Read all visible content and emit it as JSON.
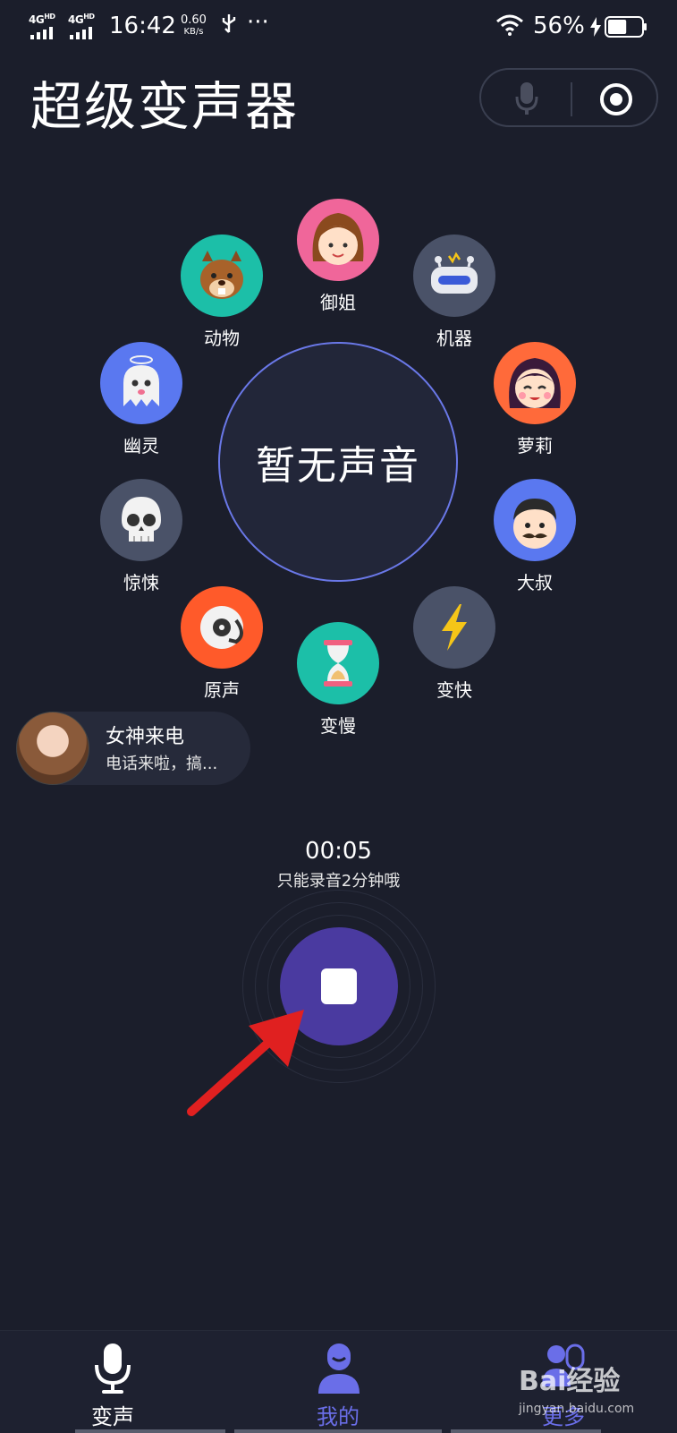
{
  "status_bar": {
    "network1": "4G",
    "network1_sup": "HD",
    "network2": "4G",
    "network2_sup": "HD",
    "time": "16:42",
    "speed_value": "0.60",
    "speed_unit": "KB/s",
    "more": "···",
    "battery": "56%",
    "battery_level": 0.56
  },
  "header": {
    "title": "超级变声器"
  },
  "center": {
    "label": "暂无声音"
  },
  "voices": [
    {
      "label": "御姐",
      "icon": "woman-face-icon",
      "bg": "#f0669a"
    },
    {
      "label": "机器",
      "icon": "robot-icon",
      "bg": "#4a5268"
    },
    {
      "label": "萝莉",
      "icon": "girl-face-icon",
      "bg": "#ff6a3a"
    },
    {
      "label": "大叔",
      "icon": "uncle-face-icon",
      "bg": "#5a78f0"
    },
    {
      "label": "变快",
      "icon": "lightning-icon",
      "bg": "#4a5268"
    },
    {
      "label": "变慢",
      "icon": "hourglass-icon",
      "bg": "#1cbfa8"
    },
    {
      "label": "原声",
      "icon": "turntable-icon",
      "bg": "#ff5a2a"
    },
    {
      "label": "惊悚",
      "icon": "skull-icon",
      "bg": "#4a5268"
    },
    {
      "label": "幽灵",
      "icon": "ghost-icon",
      "bg": "#5a78f0"
    },
    {
      "label": "动物",
      "icon": "squirrel-icon",
      "bg": "#1cbfa8"
    }
  ],
  "bubble": {
    "title": "女神来电",
    "subtitle": "电话来啦，搞..."
  },
  "recorder": {
    "time": "00:05",
    "limit_note": "只能录音2分钟哦"
  },
  "nav": [
    {
      "label": "变声",
      "icon": "microphone-icon"
    },
    {
      "label": "我的",
      "icon": "person-icon"
    },
    {
      "label": "更多",
      "icon": "people-icon"
    }
  ],
  "watermark": {
    "text": "Bai经验",
    "sub": "jingyan.baidu.com"
  },
  "colors": {
    "accent": "#6a78e8",
    "active_nav": "#6a6ee8",
    "record": "#4a3aa0",
    "background": "#1b1e2b"
  }
}
